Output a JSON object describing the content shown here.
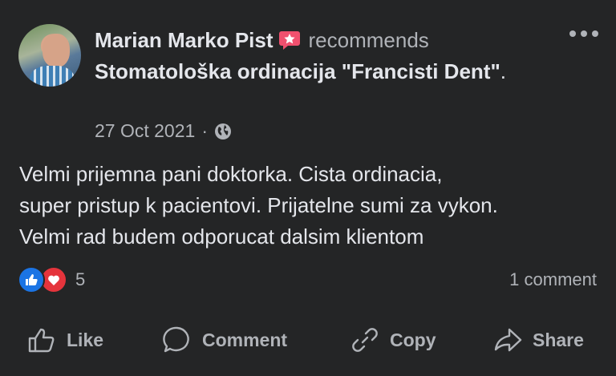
{
  "post": {
    "author": "Marian Marko Pist",
    "verb": "recommends",
    "page_name": "Stomatološka ordinacija \"Francisti Dent\"",
    "page_name_suffix": ".",
    "date": "27 Oct 2021",
    "separator": "·",
    "privacy_icon": "globe-icon",
    "body_lines": [
      "Velmi prijemna pani doktorka. Cista ordinacia,",
      "super pristup k pacientovi. Prijatelne sumi za vykon.",
      "Velmi rad budem odporucat dalsim klientom"
    ],
    "reaction_icons": [
      "like-reaction-icon",
      "love-reaction-icon"
    ],
    "reaction_count": "5",
    "comment_count": "1 comment"
  },
  "actions": {
    "like_label": "Like",
    "comment_label": "Comment",
    "copy_label": "Copy",
    "share_label": "Share"
  },
  "colors": {
    "background": "#242526",
    "primary_text": "#e4e6eb",
    "secondary_text": "#b0b3b8",
    "like_blue": "#1b74e4",
    "love_red": "#e5343c",
    "badge_pink": "#f0506e"
  }
}
